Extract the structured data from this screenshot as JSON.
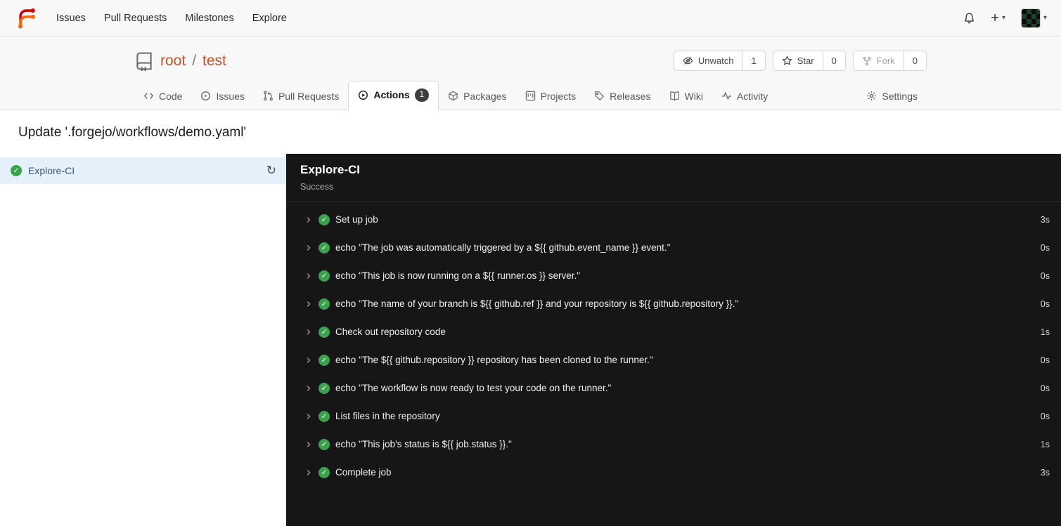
{
  "colors": {
    "accent": "#c4512c",
    "logo_red": "#d40000",
    "logo_orange": "#ff6600",
    "success_green": "#38a34a",
    "selected_bg": "#e4f1fa",
    "panel_bg": "#161616",
    "header_bg": "#f8f8f8"
  },
  "icons": {
    "check": "✓",
    "caret_down": "▾",
    "plus": "+",
    "refresh": "↻"
  },
  "navbar": {
    "items": [
      {
        "label": "Issues"
      },
      {
        "label": "Pull Requests"
      },
      {
        "label": "Milestones"
      },
      {
        "label": "Explore"
      }
    ]
  },
  "repo": {
    "owner": "root",
    "separator": "/",
    "name": "test",
    "watch": {
      "label": "Unwatch",
      "count": "1"
    },
    "star": {
      "label": "Star",
      "count": "0"
    },
    "fork": {
      "label": "Fork",
      "count": "0"
    }
  },
  "tabs": [
    {
      "label": "Code"
    },
    {
      "label": "Issues"
    },
    {
      "label": "Pull Requests"
    },
    {
      "label": "Actions",
      "count": "1"
    },
    {
      "label": "Packages"
    },
    {
      "label": "Projects"
    },
    {
      "label": "Releases"
    },
    {
      "label": "Wiki"
    },
    {
      "label": "Activity"
    },
    {
      "label": "Settings"
    }
  ],
  "run": {
    "title": "Update '.forgejo/workflows/demo.yaml'"
  },
  "sidebar": {
    "job_label": "Explore-CI"
  },
  "panel": {
    "job_name": "Explore-CI",
    "status": "Success"
  },
  "steps": [
    {
      "name": "Set up job",
      "duration": "3s"
    },
    {
      "name": "echo \"The job was automatically triggered by a ${{ github.event_name }} event.\"",
      "duration": "0s"
    },
    {
      "name": "echo \"This job is now running on a ${{ runner.os }} server.\"",
      "duration": "0s"
    },
    {
      "name": "echo \"The name of your branch is ${{ github.ref }} and your repository is ${{ github.repository }}.\"",
      "duration": "0s"
    },
    {
      "name": "Check out repository code",
      "duration": "1s"
    },
    {
      "name": "echo \"The ${{ github.repository }} repository has been cloned to the runner.\"",
      "duration": "0s"
    },
    {
      "name": "echo \"The workflow is now ready to test your code on the runner.\"",
      "duration": "0s"
    },
    {
      "name": "List files in the repository",
      "duration": "0s"
    },
    {
      "name": "echo \"This job's status is ${{ job.status }}.\"",
      "duration": "1s"
    },
    {
      "name": "Complete job",
      "duration": "3s"
    }
  ]
}
